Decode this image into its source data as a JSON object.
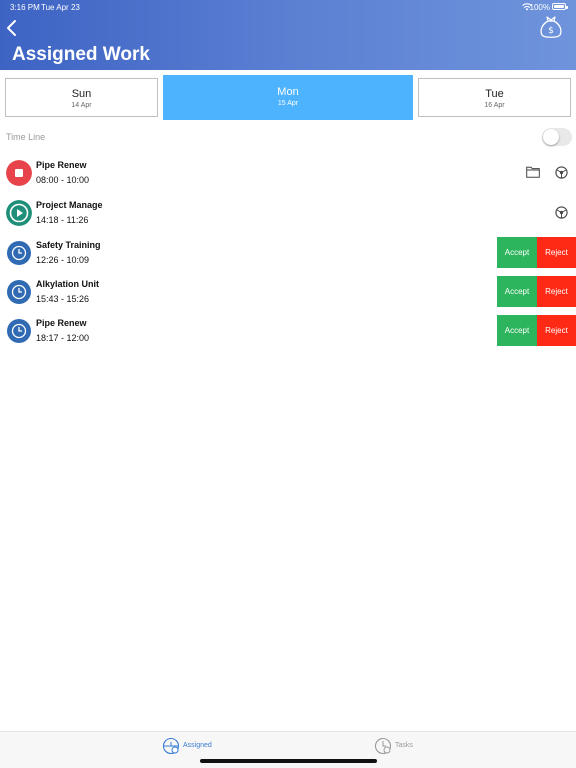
{
  "status_bar": {
    "time": "3:16 PM",
    "date": "Tue Apr 23",
    "battery": "100%"
  },
  "header": {
    "title": "Assigned Work",
    "back_icon": "chevron-left-icon",
    "action_icon": "money-bag-icon"
  },
  "colors": {
    "header_start": "#3d63c4",
    "header_end": "#6f94dc",
    "selected_day": "#4db3ff",
    "accept": "#2db55d",
    "reject": "#ff2a16",
    "stop": "#e8434b",
    "play": "#1f8f7a",
    "pending": "#2f6ab3"
  },
  "days": [
    {
      "name": "Sun",
      "date": "14 Apr"
    },
    {
      "name": "Mon",
      "date": "15 Apr",
      "selected": true
    },
    {
      "name": "Tue",
      "date": "16 Apr"
    }
  ],
  "timeline": {
    "label": "Time Line",
    "enabled": false
  },
  "tasks": [
    {
      "name": "Pipe Renew",
      "time": "08:00 - 10:00",
      "state": "running",
      "icon": "stop-icon",
      "actions": [
        "folder-icon",
        "gear-icon"
      ]
    },
    {
      "name": "Project Manage",
      "time": "14:18 - 11:26",
      "state": "paused",
      "icon": "play-icon",
      "actions": [
        "gear-icon"
      ]
    },
    {
      "name": "Safety Training",
      "time": "12:26 - 10:09",
      "state": "pending",
      "icon": "clock-icon",
      "accept_label": "Accept",
      "reject_label": "Reject"
    },
    {
      "name": "Alkylation Unit",
      "time": "15:43 - 15:26",
      "state": "pending",
      "icon": "clock-icon",
      "accept_label": "Accept",
      "reject_label": "Reject"
    },
    {
      "name": "Pipe Renew",
      "time": "18:17 - 12:00",
      "state": "pending",
      "icon": "clock-icon",
      "accept_label": "Accept",
      "reject_label": "Reject"
    }
  ],
  "tabbar": {
    "tabs": [
      {
        "label": "Assigned",
        "icon": "assigned-clock-icon",
        "active": true
      },
      {
        "label": "Tasks",
        "icon": "tasks-clock-icon",
        "active": false
      }
    ]
  }
}
